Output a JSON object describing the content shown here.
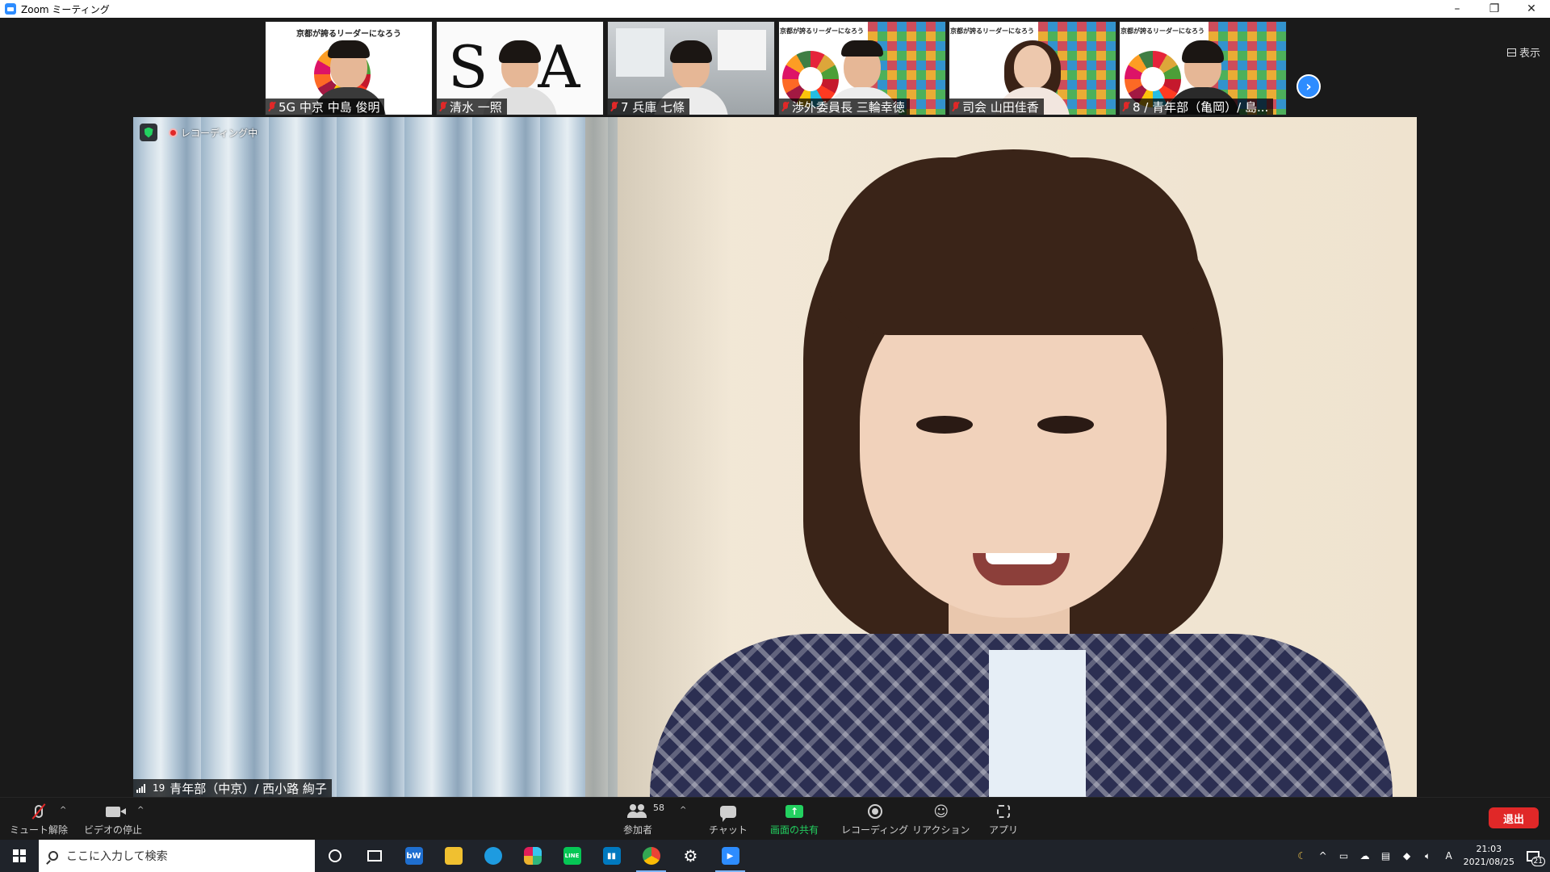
{
  "window": {
    "title": "Zoom ミーティング",
    "controls": [
      "–",
      "❐",
      "✕"
    ]
  },
  "thumbnails": [
    {
      "label": "5G 中京 中島 俊明",
      "slide_title": "京都が誇るリーダーになろう",
      "kind": "slide"
    },
    {
      "label": "清水  一照",
      "slide_title": "SA",
      "kind": "logo"
    },
    {
      "label": "7 兵庫  七條",
      "kind": "office"
    },
    {
      "label": "渉外委員長 三輪幸徳",
      "slide_title": "京都が誇るリーダーになろう",
      "kind": "tiles"
    },
    {
      "label": "司会  山田佳香",
      "slide_title": "京都が誇るリーダーになろう",
      "kind": "tiles"
    },
    {
      "label": "8 / 青年部（亀岡）/ 島...",
      "slide_title": "京都が誇るリーダーになろう",
      "kind": "tiles"
    }
  ],
  "view_button": "表示",
  "next_page_icon": "chevron-right-icon",
  "stage": {
    "recording_label": "レコーディング中",
    "speaker_signal": "19",
    "speaker_name": "青年部（中京）/ 西小路  絢子"
  },
  "toolbar": {
    "mute": "ミュート解除",
    "video": "ビデオの停止",
    "participants": "参加者",
    "participants_count": "58",
    "chat": "チャット",
    "share": "画面の共有",
    "record": "レコーディング",
    "reactions": "リアクション",
    "apps": "アプリ",
    "leave": "退出"
  },
  "taskbar": {
    "search_placeholder": "ここに入力して検索",
    "apps": [
      "cortana",
      "task-view",
      "bw-app",
      "file-explorer",
      "edge",
      "slack",
      "line",
      "trello",
      "chrome",
      "settings",
      "zoom"
    ],
    "time": "21:03",
    "date": "2021/08/25",
    "ime": "A",
    "notifications": "21"
  },
  "colors": {
    "accent_blue": "#2d8cff",
    "leave_red": "#e02828",
    "share_green": "#23d160"
  }
}
